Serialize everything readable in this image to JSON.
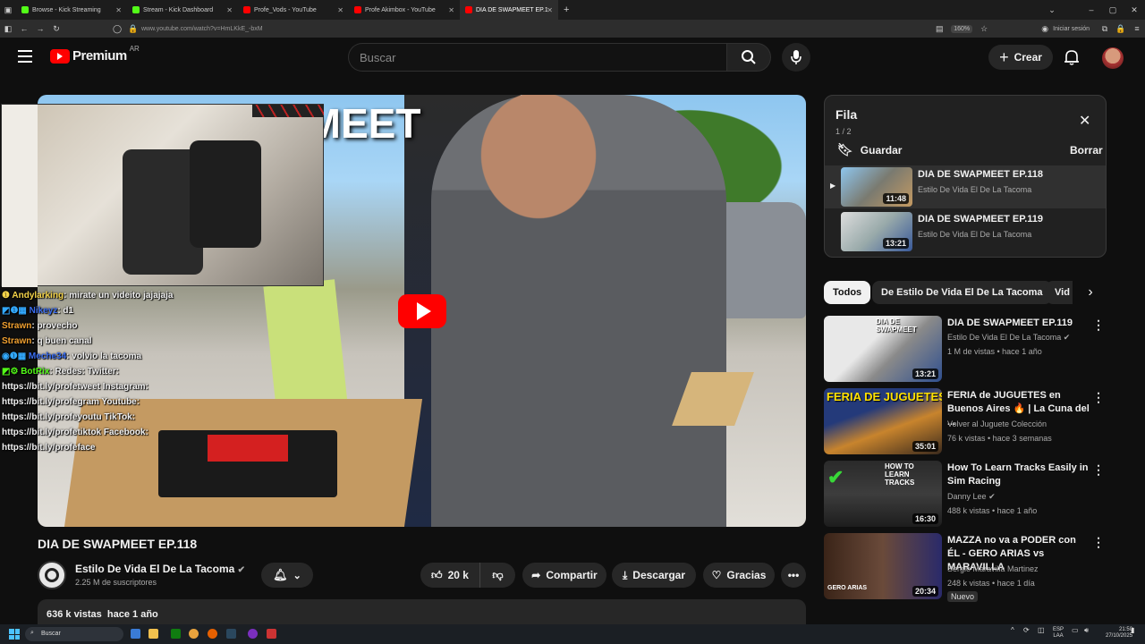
{
  "browser": {
    "tabs": [
      {
        "label": "Browse - Kick Streaming",
        "color": "#53fc18"
      },
      {
        "label": "Stream - Kick Dashboard",
        "color": "#53fc18"
      },
      {
        "label": "Profe_Vods - YouTube",
        "color": "#ff0000"
      },
      {
        "label": "Profe Akimbox - YouTube",
        "color": "#ff0000"
      },
      {
        "label": "DIA DE SWAPMEET EP.118 - Yo",
        "color": "#ff0000"
      }
    ],
    "new_tab": "+",
    "url": "www.youtube.com/watch?v=HmLKkE_-bxM",
    "zoom": "160%",
    "signin": "Iniciar sesión"
  },
  "youtube": {
    "logo": "Premium",
    "region": "AR",
    "search_placeholder": "Buscar",
    "create_label": "Crear",
    "video": {
      "banner_text": "PMEET",
      "title": "DIA DE SWAPMEET EP.118",
      "channel": "Estilo De Vida El De La Tacoma",
      "subscribers": "2.25 M de suscriptores",
      "likes": "20 k",
      "share": "Compartir",
      "download": "Descargar",
      "thanks": "Gracias",
      "views": "636 k vistas",
      "age": "hace 1 año"
    },
    "chat": [
      {
        "user": "Andylarking",
        "msg": ": mirate un videito jajajaja",
        "color": "#f5d44a"
      },
      {
        "user": "Nikeyz",
        "msg": ": d1",
        "color": "#3a6df0"
      },
      {
        "user": "Strawn",
        "msg": ": provecho",
        "color": "#f0a030"
      },
      {
        "user": "Strawn",
        "msg": ": q buen canal",
        "color": "#f0a030"
      },
      {
        "user": "Meche34",
        "msg": ": volvio la tacoma",
        "color": "#3a6df0"
      },
      {
        "user": "BotRix",
        "msg": ": Redes: Twitter:",
        "color": "#53fc18"
      },
      {
        "user": "",
        "msg": "https://bit.ly/profetweet Instagram:",
        "color": "#fff"
      },
      {
        "user": "",
        "msg": "https://bit.ly/profegram Youtube:",
        "color": "#fff"
      },
      {
        "user": "",
        "msg": "https://bit.ly/profeyoutu TikTok:",
        "color": "#fff"
      },
      {
        "user": "",
        "msg": "https://bit.ly/profetiktok Facebook:",
        "color": "#fff"
      },
      {
        "user": "",
        "msg": "https://bit.ly/profeface",
        "color": "#fff"
      }
    ],
    "queue": {
      "title": "Fila",
      "position": "1 / 2",
      "save": "Guardar",
      "clear": "Borrar",
      "items": [
        {
          "title": "DIA DE SWAPMEET EP.118",
          "channel": "Estilo De Vida El De La Tacoma",
          "duration": "11:48"
        },
        {
          "title": "DIA DE SWAPMEET EP.119",
          "channel": "Estilo De Vida El De La Tacoma",
          "duration": "13:21"
        }
      ]
    },
    "chips": [
      "Todos",
      "De Estilo De Vida El De La Tacoma",
      "Vid"
    ],
    "recommendations": [
      {
        "title": "DIA DE SWAPMEET EP.119",
        "channel": "Estilo De Vida El De La Tacoma",
        "meta": "1 M de vistas • hace 1 año",
        "duration": "13:21",
        "thumb_text": "DIA DE SWAPMEET",
        "verified": true,
        "badge": ""
      },
      {
        "title": "FERIA de JUGUETES en Buenos Aires 🔥 | La Cuna del ...",
        "channel": "Volver al Juguete Colección",
        "meta": "76 k vistas • hace 3 semanas",
        "duration": "35:01",
        "thumb_text": "FERIA DE JUGUETES",
        "verified": false,
        "badge": ""
      },
      {
        "title": "How To Learn Tracks Easily in Sim Racing",
        "channel": "Danny Lee",
        "meta": "488 k vistas • hace 1 año",
        "duration": "16:30",
        "thumb_text": "HOW TO LEARN TRACKS",
        "verified": true,
        "badge": ""
      },
      {
        "title": "MAZZA no va a PODER con ÉL - GERO ARIAS vs MARAVILLA",
        "channel": "Sergio Maravilla Martinez",
        "meta": "248 k vistas • hace 1 día",
        "duration": "20:34",
        "thumb_text": "GERO ARIAS",
        "verified": false,
        "badge": "Nuevo"
      }
    ]
  },
  "taskbar": {
    "search": "Buscar",
    "lang": "ESP",
    "lang2": "LAA",
    "time": "21:50",
    "date": "27/10/2025"
  }
}
